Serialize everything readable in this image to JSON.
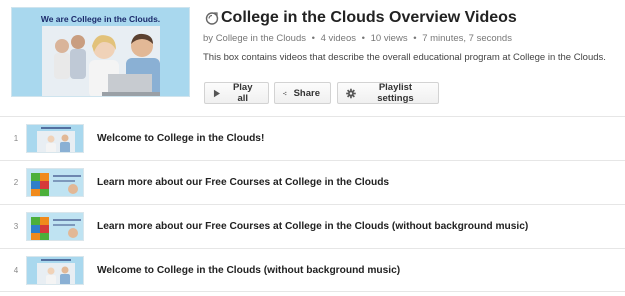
{
  "header": {
    "thumbnail_caption": "We are College in the Clouds.",
    "title": "College in the Clouds Overview Videos",
    "owner_prefix": "by",
    "owner": "College in the Clouds",
    "video_count": "4 videos",
    "view_count": "10 views",
    "duration": "7 minutes, 7 seconds",
    "description": "This box contains videos that describe the overall educational program at College in the Clouds."
  },
  "toolbar": {
    "play_all_label": "Play all",
    "share_label": "Share",
    "settings_label": "Playlist settings"
  },
  "videos": [
    {
      "index": "1",
      "title": "Welcome to College in the Clouds!",
      "thumb": "people"
    },
    {
      "index": "2",
      "title": "Learn more about our Free Courses at College in the Clouds",
      "thumb": "puzzle"
    },
    {
      "index": "3",
      "title": "Learn more about our Free Courses at College in the Clouds (without background music)",
      "thumb": "puzzle"
    },
    {
      "index": "4",
      "title": "Welcome to College in the Clouds (without background music)",
      "thumb": "people"
    }
  ],
  "icons": {
    "title": "playlist-globe-icon",
    "play": "play-icon",
    "share": "share-icon",
    "settings": "gear-icon"
  },
  "colors": {
    "thumb_sky": "#9fd3ec",
    "caption": "#1b2a6b",
    "puzzle_green": "#4caf3a",
    "puzzle_orange": "#f08a1c",
    "puzzle_blue": "#2f7fc9",
    "puzzle_red": "#d63a3a"
  }
}
